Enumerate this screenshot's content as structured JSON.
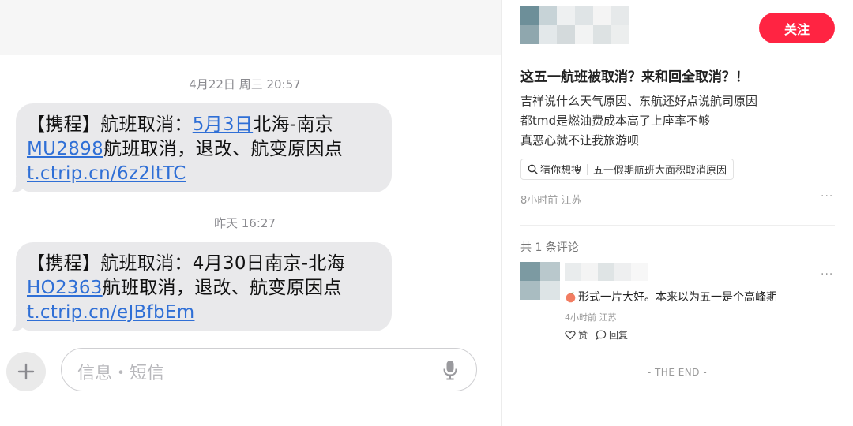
{
  "sms": {
    "messages": [
      {
        "time": "4月22日 周三 20:57",
        "line1_prefix": "【携程】航班取消：",
        "line1_link": "5月3日",
        "line1_suffix": "北海-南京",
        "line2_link": "MU2898",
        "line2_suffix": "航班取消，退改、航变原因点",
        "line3_link": "t.ctrip.cn/6z2ltTC"
      },
      {
        "time": "昨天 16:27",
        "line1_text": "【携程】航班取消：4月30日南京-北海",
        "line2_link": "HO2363",
        "line2_suffix": "航班取消，退改、航变原因点",
        "line3_link": "t.ctrip.cn/eJBfbEm"
      }
    ],
    "input_placeholder": "信息・短信"
  },
  "post": {
    "follow_label": "关注",
    "title": "这五一航班被取消？来和回全取消？！",
    "body_lines": [
      "吉祥说什么天气原因、东航还好点说航司原因",
      "都tmd是燃油费成本高了上座率不够",
      "真恶心就不让我旅游呗"
    ],
    "search_chip": {
      "label": "猜你想搜",
      "query": "五一假期航班大面积取消原因"
    },
    "meta": "8小时前 江苏",
    "more": "···",
    "comments_count": "共 1 条评论",
    "comment": {
      "text": "形式一片大好。本来以为五一是个高峰期",
      "meta": "4小时前 江苏",
      "like_label": "赞",
      "reply_label": "回复"
    },
    "end_text": "- THE END -"
  },
  "colors": {
    "accent": "#ff2442",
    "link": "#2f6fd6",
    "bubble": "#e9e9eb"
  }
}
